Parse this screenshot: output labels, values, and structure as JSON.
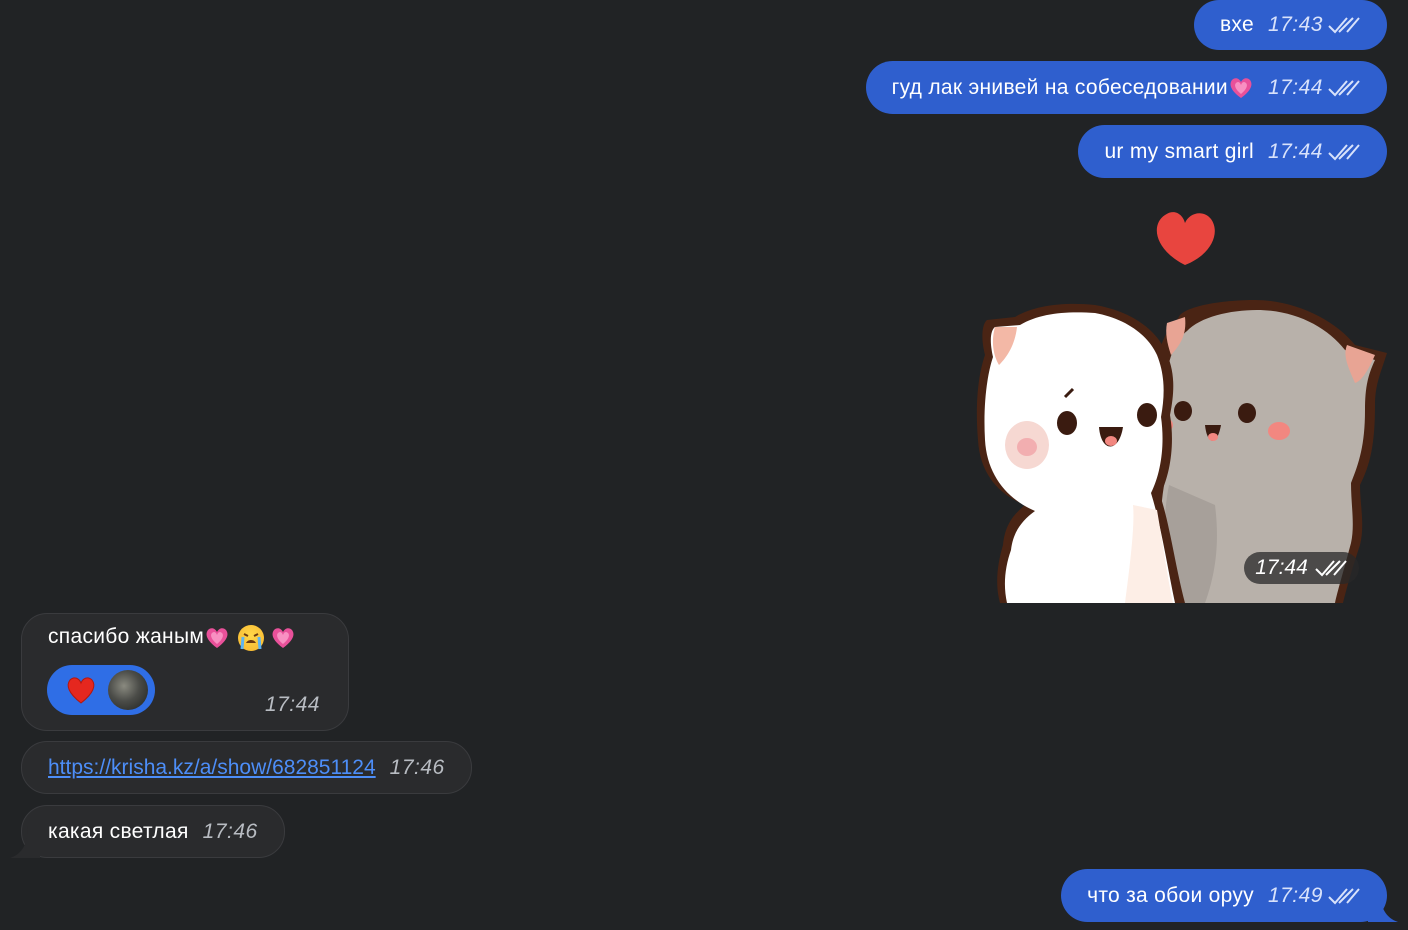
{
  "colors": {
    "background": "#212325",
    "outgoing_bubble": "#2f5fce",
    "incoming_bubble": "#2a2b2d",
    "link": "#4d8ef8",
    "reaction_bg": "#2f6ee6"
  },
  "messages": {
    "m1": {
      "text": "вхе",
      "time": "17:43",
      "status_icon": "double-check-icon"
    },
    "m2": {
      "text": "гуд лак энивей на собеседовании",
      "emoji": "sparkling-heart-icon",
      "time": "17:44",
      "status_icon": "double-check-icon"
    },
    "m3": {
      "text": "ur my smart girl",
      "time": "17:44",
      "status_icon": "double-check-icon"
    },
    "sticker": {
      "description_icon": "cats-hug-sticker",
      "time": "17:44",
      "status_icon": "double-check-icon"
    },
    "m5": {
      "text": "спасибо жаным",
      "emojis": [
        "sparkling-heart-icon",
        "loudly-crying-face-icon",
        "sparkling-heart-icon"
      ],
      "time": "17:44",
      "reaction": {
        "emoji": "red-heart-icon",
        "avatar": "avatar"
      }
    },
    "m6": {
      "link": "https://krisha.kz/a/show/682851124",
      "time": "17:46"
    },
    "m7": {
      "text": "какая светлая",
      "time": "17:46"
    },
    "m8": {
      "text": "что за обои оруу",
      "time": "17:49",
      "status_icon": "double-check-icon"
    }
  }
}
